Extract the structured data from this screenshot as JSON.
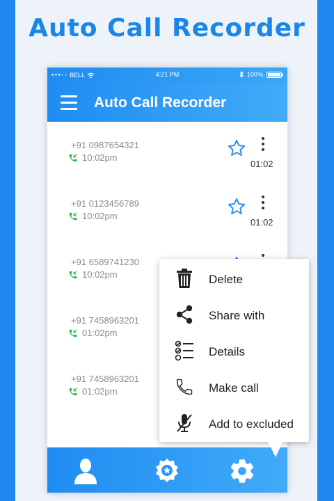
{
  "promo": {
    "title": "Auto Call Recorder"
  },
  "status_bar": {
    "carrier": "BELL",
    "time": "4:21 PM",
    "battery": "100%",
    "battery_level": 1.0
  },
  "app_bar": {
    "title": "Auto Call Recorder",
    "menu_icon": "hamburger-icon"
  },
  "recordings": [
    {
      "number": "+91 0987654321",
      "time": "10:02pm",
      "duration": "01:02"
    },
    {
      "number": "+91 0123456789",
      "time": "10:02pm",
      "duration": "01:02"
    },
    {
      "number": "+91 6589741230",
      "time": "10:02pm",
      "duration": ""
    },
    {
      "number": "+91 7458963201",
      "time": "01:02pm",
      "duration": ""
    },
    {
      "number": "+91 7458963201",
      "time": "01:02pm",
      "duration": ""
    }
  ],
  "context_menu": {
    "items": [
      {
        "label": "Delete",
        "icon": "trash-icon"
      },
      {
        "label": "Share with",
        "icon": "share-icon"
      },
      {
        "label": "Details",
        "icon": "details-list-icon"
      },
      {
        "label": "Make call",
        "icon": "phone-icon"
      },
      {
        "label": "Add to excluded",
        "icon": "mic-off-icon"
      }
    ]
  },
  "bottom_nav": [
    {
      "icon": "user-icon"
    },
    {
      "icon": "badge-icon"
    },
    {
      "icon": "gear-icon"
    }
  ],
  "colors": {
    "primary": "#1f8cf2",
    "primary_light": "#41abf8",
    "title_blue": "#1a86ea",
    "call_green": "#2fb34a",
    "star_blue": "#2b8ef0",
    "text_gray": "#8a8a8a"
  }
}
